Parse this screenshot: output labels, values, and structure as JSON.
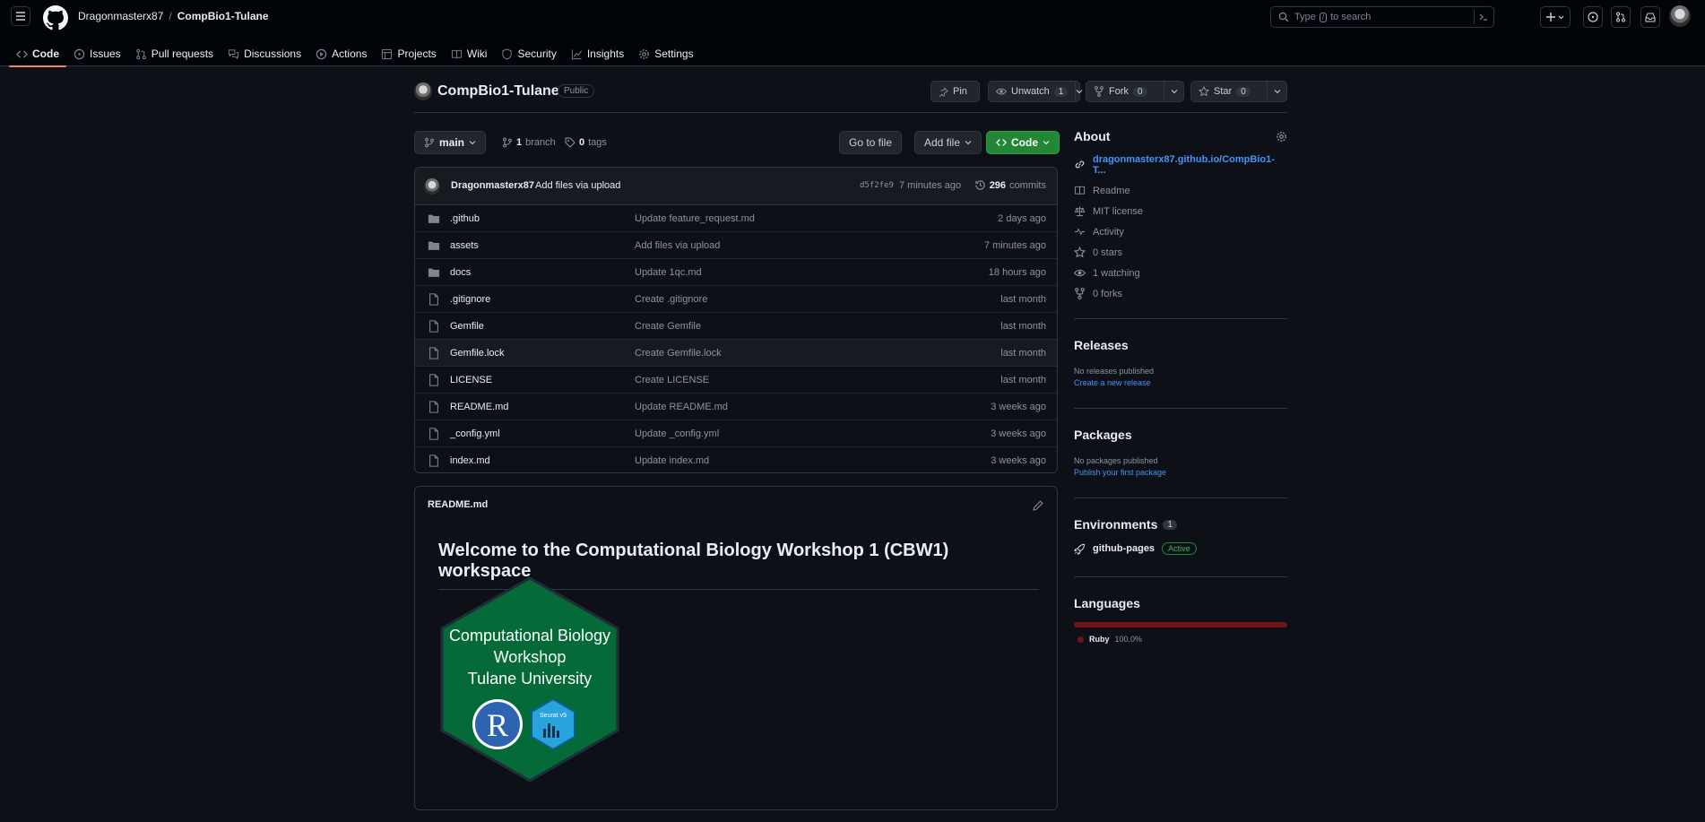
{
  "header": {
    "owner": "Dragonmasterx87",
    "separator": "/",
    "repo": "CompBio1-Tulane",
    "search": {
      "pre": "Type",
      "key": "/",
      "post": "to search"
    }
  },
  "tabs": [
    {
      "label": "Code",
      "icon": "code-icon"
    },
    {
      "label": "Issues",
      "icon": "issue-icon"
    },
    {
      "label": "Pull requests",
      "icon": "pull-request-icon"
    },
    {
      "label": "Discussions",
      "icon": "discussions-icon"
    },
    {
      "label": "Actions",
      "icon": "play-icon"
    },
    {
      "label": "Projects",
      "icon": "table-icon"
    },
    {
      "label": "Wiki",
      "icon": "book-icon"
    },
    {
      "label": "Security",
      "icon": "shield-icon"
    },
    {
      "label": "Insights",
      "icon": "graph-icon"
    },
    {
      "label": "Settings",
      "icon": "gear-icon"
    }
  ],
  "repo": {
    "name": "CompBio1-Tulane",
    "visibility": "Public",
    "pin": "Pin",
    "unwatch": "Unwatch",
    "watch_count": "1",
    "fork": "Fork",
    "fork_count": "0",
    "star": "Star",
    "star_count": "0"
  },
  "toolbar": {
    "branch": "main",
    "branch_count": "1",
    "branch_label": "branch",
    "tag_count": "0",
    "tag_label": "tags",
    "go_to_file": "Go to file",
    "add_file": "Add file",
    "code": "Code"
  },
  "commit": {
    "author": "Dragonmasterx87",
    "message": "Add files via upload",
    "sha": "d5f2fe9",
    "ago": "7 minutes ago",
    "count": "296",
    "count_label": "commits"
  },
  "files": [
    {
      "type": "dir",
      "name": ".github",
      "message": "Update feature_request.md",
      "time": "2 days ago"
    },
    {
      "type": "dir",
      "name": "assets",
      "message": "Add files via upload",
      "time": "7 minutes ago"
    },
    {
      "type": "dir",
      "name": "docs",
      "message": "Update 1qc.md",
      "time": "18 hours ago"
    },
    {
      "type": "file",
      "name": ".gitignore",
      "message": "Create .gitignore",
      "time": "last month"
    },
    {
      "type": "file",
      "name": "Gemfile",
      "message": "Create Gemfile",
      "time": "last month"
    },
    {
      "type": "file",
      "name": "Gemfile.lock",
      "message": "Create Gemfile.lock",
      "time": "last month"
    },
    {
      "type": "file",
      "name": "LICENSE",
      "message": "Create LICENSE",
      "time": "last month"
    },
    {
      "type": "file",
      "name": "README.md",
      "message": "Update README.md",
      "time": "3 weeks ago"
    },
    {
      "type": "file",
      "name": "_config.yml",
      "message": "Update _config.yml",
      "time": "3 weeks ago"
    },
    {
      "type": "file",
      "name": "index.md",
      "message": "Update index.md",
      "time": "3 weeks ago"
    }
  ],
  "readme": {
    "filename": "README.md",
    "heading": "Welcome to the Computational Biology Workshop 1 (CBW1) workspace",
    "logo": {
      "line1": "Computational Biology",
      "line2": "Workshop",
      "line3": "Tulane University",
      "r_letter": "R",
      "seurat": "Seurat v5",
      "hex_color": "#046a38"
    }
  },
  "about": {
    "title": "About",
    "link": "dragonmasterx87.github.io/CompBio1-T...",
    "items": [
      {
        "icon": "book-icon",
        "label": "Readme"
      },
      {
        "icon": "law-icon",
        "label": "MIT license"
      },
      {
        "icon": "pulse-icon",
        "label": "Activity"
      },
      {
        "icon": "star-icon",
        "label": "0 stars"
      },
      {
        "icon": "eye-icon",
        "label": "1 watching"
      },
      {
        "icon": "fork-icon",
        "label": "0 forks"
      }
    ]
  },
  "releases": {
    "title": "Releases",
    "none": "No releases published",
    "link": "Create a new release"
  },
  "packages": {
    "title": "Packages",
    "none": "No packages published",
    "link": "Publish your first package"
  },
  "environments": {
    "title": "Environments",
    "count": "1",
    "name": "github-pages",
    "status": "Active"
  },
  "languages": {
    "title": "Languages",
    "name": "Ruby",
    "percent": "100.0%",
    "color": "#701516"
  },
  "colors": {
    "accent_green": "#238636",
    "link_blue": "#4493f8",
    "tab_underline": "#f78166"
  }
}
